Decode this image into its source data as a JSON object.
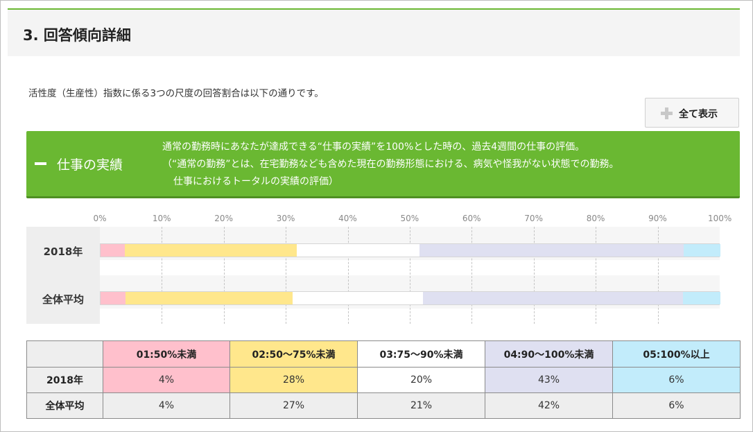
{
  "header": {
    "title": "3. 回答傾向詳細"
  },
  "intro": "活性度（生産性）指数に係る3つの尺度の回答割合は以下の通りです。",
  "show_all": {
    "label": "全て表示"
  },
  "section": {
    "title": "仕事の実績",
    "lines": [
      "通常の勤務時にあなたが達成できる“仕事の実績”を100%とした時の、過去4週間の仕事の評価。",
      "（“通常の勤務”とは、在宅勤務なども含めた現在の勤務形態における、病気や怪我がない状態での勤務。",
      "仕事におけるトータルの実績の評価）"
    ]
  },
  "colors": [
    "#ffc0cc",
    "#ffe78c",
    "#ffffff",
    "#dfe0f1",
    "#c2ecfb"
  ],
  "chart_data": {
    "type": "bar",
    "stacked": true,
    "orientation": "horizontal",
    "xlim": [
      0,
      100
    ],
    "tick_labels": [
      "0%",
      "10%",
      "20%",
      "30%",
      "40%",
      "50%",
      "60%",
      "70%",
      "80%",
      "90%",
      "100%"
    ],
    "categories": [
      "2018年",
      "全体平均"
    ],
    "series": [
      {
        "name": "01:50%未満",
        "values": [
          4,
          4
        ]
      },
      {
        "name": "02:50～75%未満",
        "values": [
          28,
          27
        ]
      },
      {
        "name": "03:75～90%未満",
        "values": [
          20,
          21
        ]
      },
      {
        "name": "04:90～100%未満",
        "values": [
          43,
          42
        ]
      },
      {
        "name": "05:100%以上",
        "values": [
          6,
          6
        ]
      }
    ]
  },
  "table": {
    "rows": [
      {
        "label": "2018年",
        "cells": [
          "4%",
          "28%",
          "20%",
          "43%",
          "6%"
        ]
      },
      {
        "label": "全体平均",
        "cells": [
          "4%",
          "27%",
          "21%",
          "42%",
          "6%"
        ]
      }
    ]
  }
}
